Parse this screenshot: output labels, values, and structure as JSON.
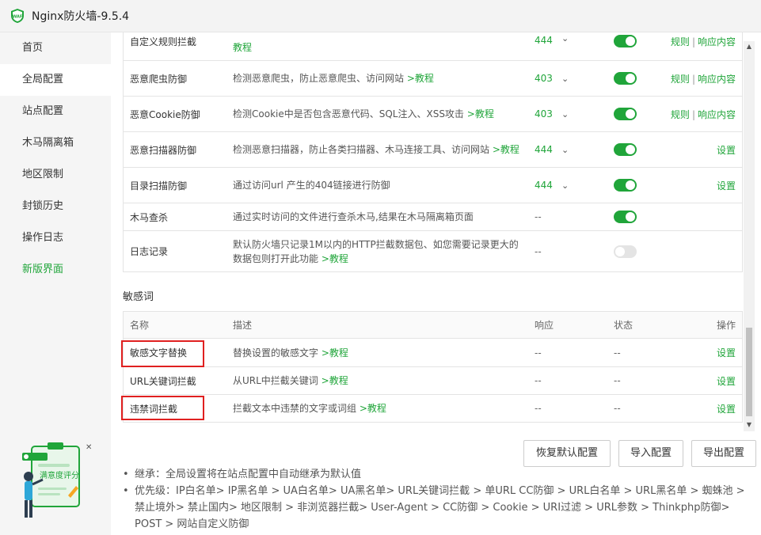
{
  "window": {
    "title": "Nginx防火墙-9.5.4"
  },
  "sidebar": {
    "items": [
      {
        "label": "首页"
      },
      {
        "label": "全局配置"
      },
      {
        "label": "站点配置"
      },
      {
        "label": "木马隔离箱"
      },
      {
        "label": "地区限制"
      },
      {
        "label": "封锁历史"
      },
      {
        "label": "操作日志"
      },
      {
        "label": "新版界面"
      }
    ],
    "survey_label": "满意度评分"
  },
  "rules": [
    {
      "name": "自定义规则拦截",
      "desc": "",
      "desc_link": "教程",
      "resp": "444",
      "status": "on",
      "op1": "规则",
      "op2": "响应内容"
    },
    {
      "name": "恶意爬虫防御",
      "desc": "检测恶意爬虫，防止恶意爬虫、访问网站",
      "desc_link": ">教程",
      "resp": "403",
      "status": "on",
      "op1": "规则",
      "op2": "响应内容"
    },
    {
      "name": "恶意Cookie防御",
      "desc": "检测Cookie中是否包含恶意代码、SQL注入、XSS攻击",
      "desc_link": ">教程",
      "resp": "403",
      "status": "on",
      "op1": "规则",
      "op2": "响应内容"
    },
    {
      "name": "恶意扫描器防御",
      "desc": "检测恶意扫描器，防止各类扫描器、木马连接工具、访问网站",
      "desc_link": ">教程",
      "resp": "444",
      "status": "on",
      "op1": "设置"
    },
    {
      "name": "目录扫描防御",
      "desc": "通过访问url 产生的404链接进行防御",
      "desc_link": "",
      "resp": "444",
      "status": "on",
      "op1": "设置"
    },
    {
      "name": "木马查杀",
      "desc": "通过实时访问的文件进行查杀木马,结果在木马隔离箱页面",
      "desc_link": "",
      "resp": "--",
      "status": "on"
    },
    {
      "name": "日志记录",
      "desc": "默认防火墙只记录1M以内的HTTP拦截数据包、如您需要记录更大的数据包则打开此功能",
      "desc_link": ">教程",
      "resp": "--",
      "status": "off"
    }
  ],
  "sensitive": {
    "title": "敏感词",
    "headers": {
      "name": "名称",
      "desc": "描述",
      "resp": "响应",
      "status": "状态",
      "op": "操作"
    },
    "rows": [
      {
        "name": "敏感文字替换",
        "desc": "替换设置的敏感文字",
        "desc_link": ">教程",
        "resp": "--",
        "status": "--",
        "op": "设置"
      },
      {
        "name": "URL关键词拦截",
        "desc": "从URL中拦截关键词",
        "desc_link": ">教程",
        "resp": "--",
        "status": "--",
        "op": "设置"
      },
      {
        "name": "违禁词拦截",
        "desc": "拦截文本中违禁的文字或词组",
        "desc_link": ">教程",
        "resp": "--",
        "status": "--",
        "op": "设置"
      }
    ]
  },
  "buttons": {
    "reset": "恢复默认配置",
    "import": "导入配置",
    "export": "导出配置"
  },
  "notes": [
    "继承：全局设置将在站点配置中自动继承为默认值",
    "优先级：IP白名单> IP黑名单 > UA白名单> UA黑名单> URL关键词拦截 > 单URL CC防御 > URL白名单 > URL黑名单 > 蜘蛛池 > 禁止境外> 禁止国内> 地区限制 > 非浏览器拦截> User-Agent > CC防御 > Cookie > URI过滤 > URL参数 > Thinkphp防御> POST > 网站自定义防御"
  ],
  "colors": {
    "accent": "#20a53a",
    "highlight": "#e02020"
  }
}
